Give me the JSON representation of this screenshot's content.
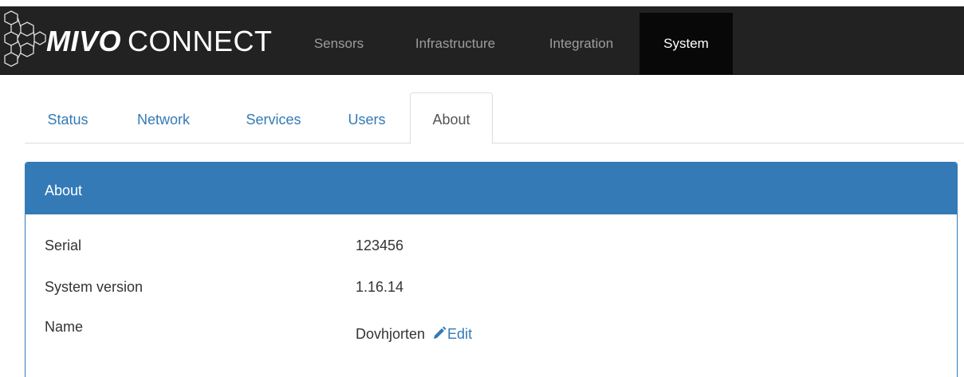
{
  "navbar": {
    "brand_bold": "MIVO",
    "brand_light": "CONNECT",
    "items": [
      {
        "label": "Sensors",
        "active": false
      },
      {
        "label": "Infrastructure",
        "active": false
      },
      {
        "label": "Integration",
        "active": false
      },
      {
        "label": "System",
        "active": true
      }
    ]
  },
  "tabs": [
    {
      "label": "Status",
      "active": false
    },
    {
      "label": "Network",
      "active": false
    },
    {
      "label": "Services",
      "active": false
    },
    {
      "label": "Users",
      "active": false
    },
    {
      "label": "About",
      "active": true
    }
  ],
  "panel": {
    "title": "About",
    "rows": [
      {
        "label": "Serial",
        "value": "123456"
      },
      {
        "label": "System version",
        "value": "1.16.14"
      },
      {
        "label": "Name",
        "value": "Dovhjorten",
        "action_label": "Edit",
        "action_icon": "pencil-icon"
      }
    ]
  },
  "colors": {
    "navbar_bg": "#222222",
    "nav_active_bg": "#080808",
    "primary": "#337ab7"
  }
}
